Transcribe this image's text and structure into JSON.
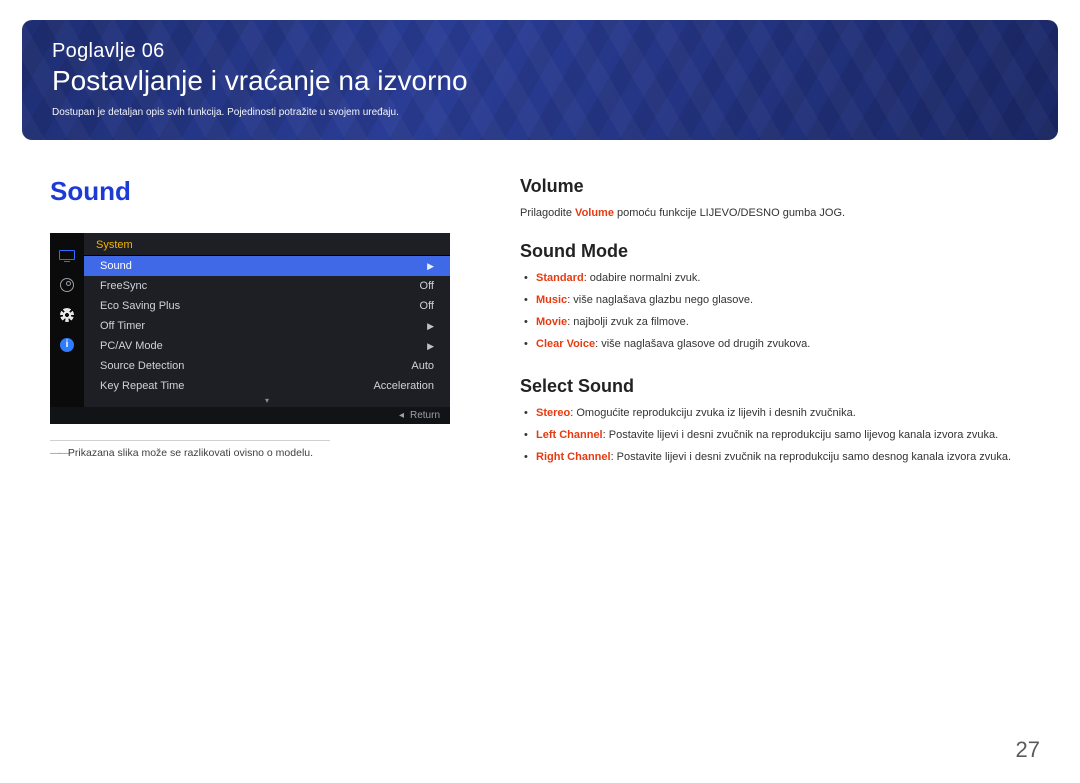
{
  "header": {
    "chapter_label": "Poglavlje  06",
    "title": "Postavljanje i vraćanje na izvorno",
    "description": "Dostupan je detaljan opis svih funkcija. Pojedinosti potražite u svojem uređaju."
  },
  "left": {
    "section_title": "Sound",
    "osd": {
      "header": "System",
      "rows": [
        {
          "label": "Sound",
          "value": "",
          "selected": true,
          "arrow": true
        },
        {
          "label": "FreeSync",
          "value": "Off",
          "selected": false,
          "arrow": false
        },
        {
          "label": "Eco Saving Plus",
          "value": "Off",
          "selected": false,
          "arrow": false
        },
        {
          "label": "Off Timer",
          "value": "",
          "selected": false,
          "arrow": true
        },
        {
          "label": "PC/AV Mode",
          "value": "",
          "selected": false,
          "arrow": true
        },
        {
          "label": "Source Detection",
          "value": "Auto",
          "selected": false,
          "arrow": false
        },
        {
          "label": "Key Repeat Time",
          "value": "Acceleration",
          "selected": false,
          "arrow": false
        }
      ],
      "footer_icon": "◂",
      "footer_label": "Return",
      "info_glyph": "i"
    },
    "footnote": "Prikazana slika može se razlikovati ovisno o modelu."
  },
  "right": {
    "volume": {
      "heading": "Volume",
      "lead_pre": "Prilagodite ",
      "lead_kw": "Volume",
      "lead_post": " pomoću funkcije LIJEVO/DESNO gumba JOG."
    },
    "sound_mode": {
      "heading": "Sound Mode",
      "items": [
        {
          "kw": "Standard",
          "text": ": odabire normalni zvuk."
        },
        {
          "kw": "Music",
          "text": ": više naglašava glazbu nego glasove."
        },
        {
          "kw": "Movie",
          "text": ": najbolji zvuk za filmove."
        },
        {
          "kw": "Clear Voice",
          "text": ": više naglašava glasove od drugih zvukova."
        }
      ]
    },
    "select_sound": {
      "heading": "Select Sound",
      "items": [
        {
          "kw": "Stereo",
          "text": ": Omogućite reprodukciju zvuka iz lijevih i desnih zvučnika."
        },
        {
          "kw": "Left Channel",
          "text": ": Postavite lijevi i desni zvučnik na reprodukciju samo lijevog kanala izvora zvuka."
        },
        {
          "kw": "Right Channel",
          "text": ": Postavite lijevi i desni zvučnik na reprodukciju samo desnog kanala izvora zvuka."
        }
      ]
    }
  },
  "page_number": "27"
}
